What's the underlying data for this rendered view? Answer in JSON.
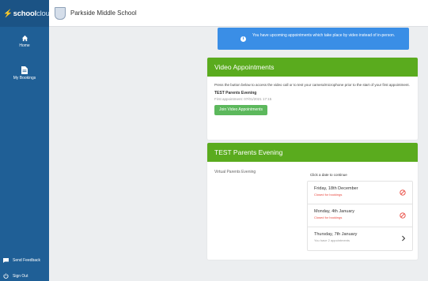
{
  "sidebar": {
    "logo_bold": "schoolcloud",
    "logo_light": "cloud",
    "items": [
      {
        "label": "Home",
        "icon": "home-icon"
      },
      {
        "label": "My Bookings",
        "icon": "document-icon"
      }
    ],
    "feedback_label": "Send Feedback",
    "signout_label": "Sign Out"
  },
  "header": {
    "school_name": "Parkside Middle School"
  },
  "alert": {
    "text": "You have upcoming appointments which take place by video instead of in-person."
  },
  "video_card": {
    "title": "Video Appointments",
    "description": "Press the button below to access the video call or to test your camera/microphone prior to the start of your first appointment.",
    "event_name": "TEST Parents Evening",
    "first_appointment": "First appointment: 07/01/2021 17:15",
    "button_label": "Join Video Appointments"
  },
  "event_card": {
    "title": "TEST Parents Evening",
    "subtitle": "Virtual Parents Evening",
    "prompt": "Click a date to continue",
    "dates": [
      {
        "title": "Friday, 18th December",
        "status": "Closed for bookings",
        "state": "closed"
      },
      {
        "title": "Monday, 4th January",
        "status": "Closed for bookings",
        "state": "closed"
      },
      {
        "title": "Thursday, 7th January",
        "status": "You have 2 appointments",
        "state": "open"
      }
    ]
  },
  "colors": {
    "sidebar": "#1f5f96",
    "card_header": "#5aab1e",
    "alert": "#3a8ee6",
    "button": "#5cb85c",
    "closed": "#e8453c"
  }
}
